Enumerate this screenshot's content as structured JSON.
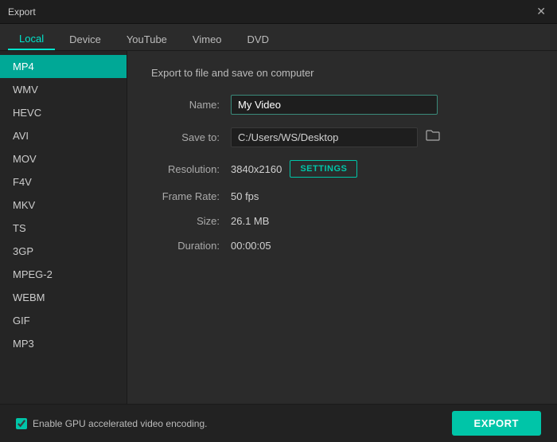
{
  "titleBar": {
    "title": "Export",
    "closeIcon": "✕"
  },
  "tabs": [
    {
      "id": "local",
      "label": "Local",
      "active": true
    },
    {
      "id": "device",
      "label": "Device",
      "active": false
    },
    {
      "id": "youtube",
      "label": "YouTube",
      "active": false
    },
    {
      "id": "vimeo",
      "label": "Vimeo",
      "active": false
    },
    {
      "id": "dvd",
      "label": "DVD",
      "active": false
    }
  ],
  "sidebar": {
    "items": [
      {
        "id": "mp4",
        "label": "MP4",
        "active": true
      },
      {
        "id": "wmv",
        "label": "WMV",
        "active": false
      },
      {
        "id": "hevc",
        "label": "HEVC",
        "active": false
      },
      {
        "id": "avi",
        "label": "AVI",
        "active": false
      },
      {
        "id": "mov",
        "label": "MOV",
        "active": false
      },
      {
        "id": "f4v",
        "label": "F4V",
        "active": false
      },
      {
        "id": "mkv",
        "label": "MKV",
        "active": false
      },
      {
        "id": "ts",
        "label": "TS",
        "active": false
      },
      {
        "id": "3gp",
        "label": "3GP",
        "active": false
      },
      {
        "id": "mpeg2",
        "label": "MPEG-2",
        "active": false
      },
      {
        "id": "webm",
        "label": "WEBM",
        "active": false
      },
      {
        "id": "gif",
        "label": "GIF",
        "active": false
      },
      {
        "id": "mp3",
        "label": "MP3",
        "active": false
      }
    ]
  },
  "content": {
    "sectionTitle": "Export to file and save on computer",
    "nameLabel": "Name:",
    "nameValue": "My Video",
    "saveToLabel": "Save to:",
    "saveToPath": "C:/Users/WS/Desktop",
    "folderIcon": "🗁",
    "resolutionLabel": "Resolution:",
    "resolutionValue": "3840x2160",
    "settingsLabel": "SETTINGS",
    "frameRateLabel": "Frame Rate:",
    "frameRateValue": "50 fps",
    "sizeLabel": "Size:",
    "sizeValue": "26.1 MB",
    "durationLabel": "Duration:",
    "durationValue": "00:00:05"
  },
  "bottomBar": {
    "gpuCheckboxChecked": true,
    "gpuLabel": "Enable GPU accelerated video encoding.",
    "exportLabel": "EXPORT"
  }
}
